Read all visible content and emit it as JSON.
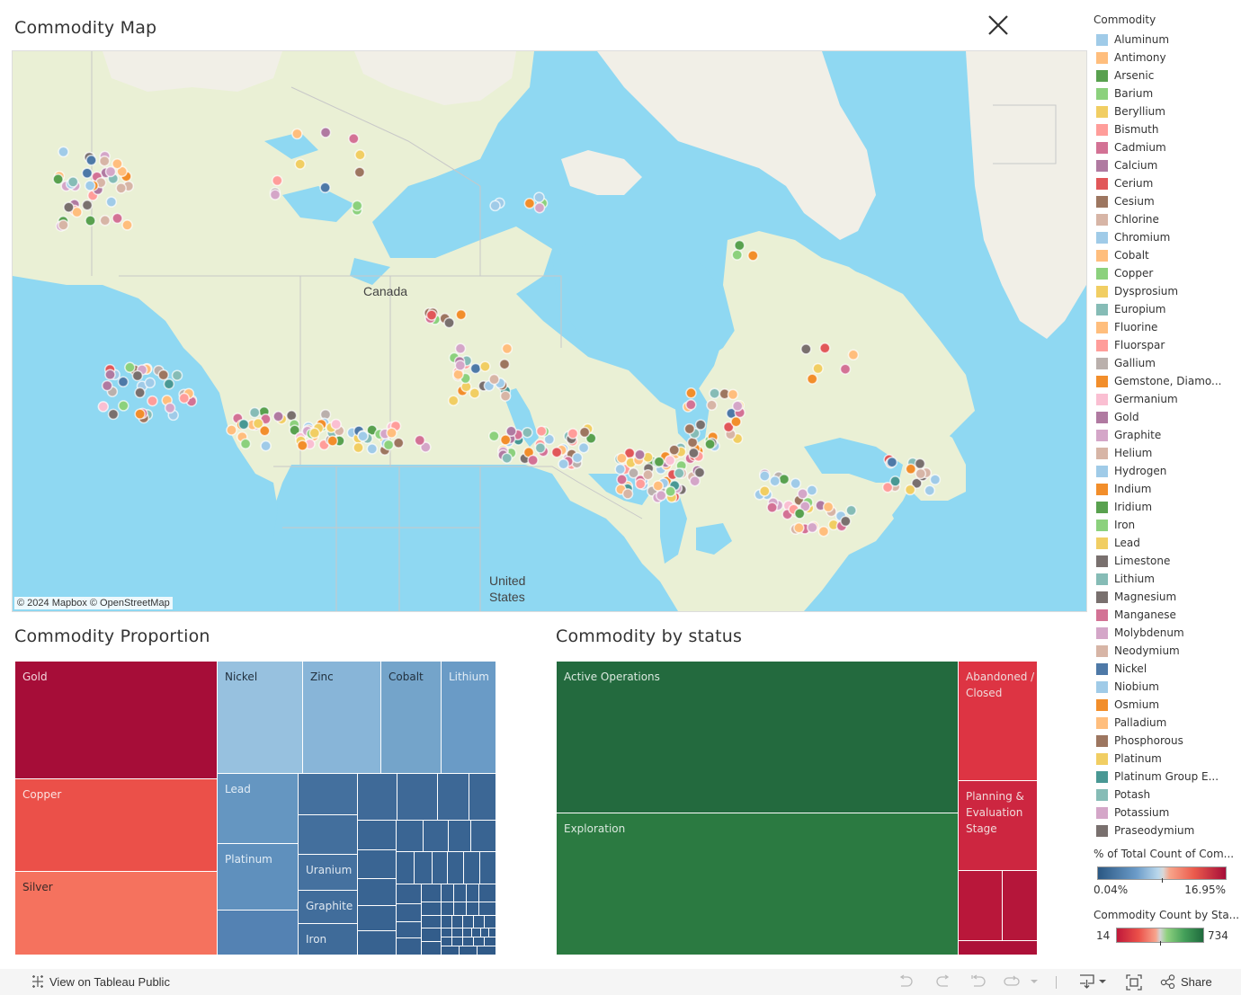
{
  "dashboard": {
    "map_title": "Commodity Map",
    "proportion_title": "Commodity Proportion",
    "status_title": "Commodity by status",
    "close_icon": "close-x-icon"
  },
  "map": {
    "labels": {
      "canada": "Canada",
      "us_line1": "United",
      "us_line2": "States"
    },
    "attribution": "© 2024 Mapbox  © OpenStreetMap"
  },
  "legend": {
    "title": "Commodity",
    "items": [
      {
        "label": "Aluminum",
        "color": "#a0cbe8"
      },
      {
        "label": "Antimony",
        "color": "#ffbe7d"
      },
      {
        "label": "Arsenic",
        "color": "#59a14f"
      },
      {
        "label": "Barium",
        "color": "#8cd17d"
      },
      {
        "label": "Beryllium",
        "color": "#f1ce63"
      },
      {
        "label": "Bismuth",
        "color": "#ff9d9a"
      },
      {
        "label": "Cadmium",
        "color": "#d37295"
      },
      {
        "label": "Calcium",
        "color": "#b07aa1"
      },
      {
        "label": "Cerium",
        "color": "#e15759"
      },
      {
        "label": "Cesium",
        "color": "#9d7660"
      },
      {
        "label": "Chlorine",
        "color": "#d7b5a6"
      },
      {
        "label": "Chromium",
        "color": "#a0cbe8"
      },
      {
        "label": "Cobalt",
        "color": "#ffbe7d"
      },
      {
        "label": "Copper",
        "color": "#8cd17d"
      },
      {
        "label": "Dysprosium",
        "color": "#f1ce63"
      },
      {
        "label": "Europium",
        "color": "#86bcb6"
      },
      {
        "label": "Fluorine",
        "color": "#ffbe7d"
      },
      {
        "label": "Fluorspar",
        "color": "#ff9d9a"
      },
      {
        "label": "Gallium",
        "color": "#bab0ac"
      },
      {
        "label": "Gemstone, Diamo...",
        "color": "#f28e2b"
      },
      {
        "label": "Germanium",
        "color": "#fabfd2"
      },
      {
        "label": "Gold",
        "color": "#b07aa1"
      },
      {
        "label": "Graphite",
        "color": "#d4a6c8"
      },
      {
        "label": "Helium",
        "color": "#d7b5a6"
      },
      {
        "label": "Hydrogen",
        "color": "#a0cbe8"
      },
      {
        "label": "Indium",
        "color": "#f28e2b"
      },
      {
        "label": "Iridium",
        "color": "#59a14f"
      },
      {
        "label": "Iron",
        "color": "#8cd17d"
      },
      {
        "label": "Lead",
        "color": "#f1ce63"
      },
      {
        "label": "Limestone",
        "color": "#79706e"
      },
      {
        "label": "Lithium",
        "color": "#86bcb6"
      },
      {
        "label": "Magnesium",
        "color": "#79706e"
      },
      {
        "label": "Manganese",
        "color": "#d37295"
      },
      {
        "label": "Molybdenum",
        "color": "#d4a6c8"
      },
      {
        "label": "Neodymium",
        "color": "#d7b5a6"
      },
      {
        "label": "Nickel",
        "color": "#4e79a7"
      },
      {
        "label": "Niobium",
        "color": "#a0cbe8"
      },
      {
        "label": "Osmium",
        "color": "#f28e2b"
      },
      {
        "label": "Palladium",
        "color": "#ffbe7d"
      },
      {
        "label": "Phosphorous",
        "color": "#9d7660"
      },
      {
        "label": "Platinum",
        "color": "#f1ce63"
      },
      {
        "label": "Platinum Group E...",
        "color": "#499894"
      },
      {
        "label": "Potash",
        "color": "#86bcb6"
      },
      {
        "label": "Potassium",
        "color": "#d4a6c8"
      },
      {
        "label": "Praseodymium",
        "color": "#79706e"
      }
    ]
  },
  "scales": {
    "percent": {
      "title": "% of Total Count of Com...",
      "min_label": "0.04%",
      "max_label": "16.95%"
    },
    "status": {
      "title": "Commodity Count by Sta...",
      "min_label": "14",
      "max_label": "734"
    }
  },
  "proportion_treemap": {
    "labeled": [
      {
        "name": "Gold",
        "color": "#a60d38",
        "text": "#f4d6dd"
      },
      {
        "name": "Copper",
        "color": "#eb5049",
        "text": "#fbe3e1"
      },
      {
        "name": "Silver",
        "color": "#f5725e",
        "text": "#3a2a28"
      },
      {
        "name": "Nickel",
        "color": "#97c1df",
        "text": "#22313f"
      },
      {
        "name": "Zinc",
        "color": "#88b5d8",
        "text": "#22313f"
      },
      {
        "name": "Cobalt",
        "color": "#74a4ca",
        "text": "#22313f"
      },
      {
        "name": "Lithium",
        "color": "#6a9bc6",
        "text": "#e2edf6"
      },
      {
        "name": "Lead",
        "color": "#6596c1",
        "text": "#e2edf6"
      },
      {
        "name": "Platinum",
        "color": "#5f90bd",
        "text": "#e2edf6"
      },
      {
        "name": "Uranium",
        "color": "#45719f",
        "text": "#dfe8f1"
      },
      {
        "name": "Graphite",
        "color": "#416d9b",
        "text": "#dfe8f1"
      },
      {
        "name": "Iron",
        "color": "#3f6b99",
        "text": "#dfe8f1"
      }
    ]
  },
  "status_treemap": {
    "cells": [
      {
        "name": "Active Operations",
        "color": "#236a3e"
      },
      {
        "name": "Exploration",
        "color": "#2b7a41"
      },
      {
        "name": "Abandoned / Closed",
        "line1": "Abandoned /",
        "line2": "Closed",
        "color": "#dd3443"
      },
      {
        "name": "Planning & Evaluation Stage",
        "line1": "Planning &",
        "line2": "Evaluation",
        "line3": "Stage",
        "color": "#cd2640"
      },
      {
        "name": "",
        "color": "#b9173a"
      },
      {
        "name": "",
        "color": "#b5163a"
      },
      {
        "name": "",
        "color": "#ad1038"
      }
    ]
  },
  "footer": {
    "view_label": "View on Tableau Public",
    "share_label": "Share"
  }
}
